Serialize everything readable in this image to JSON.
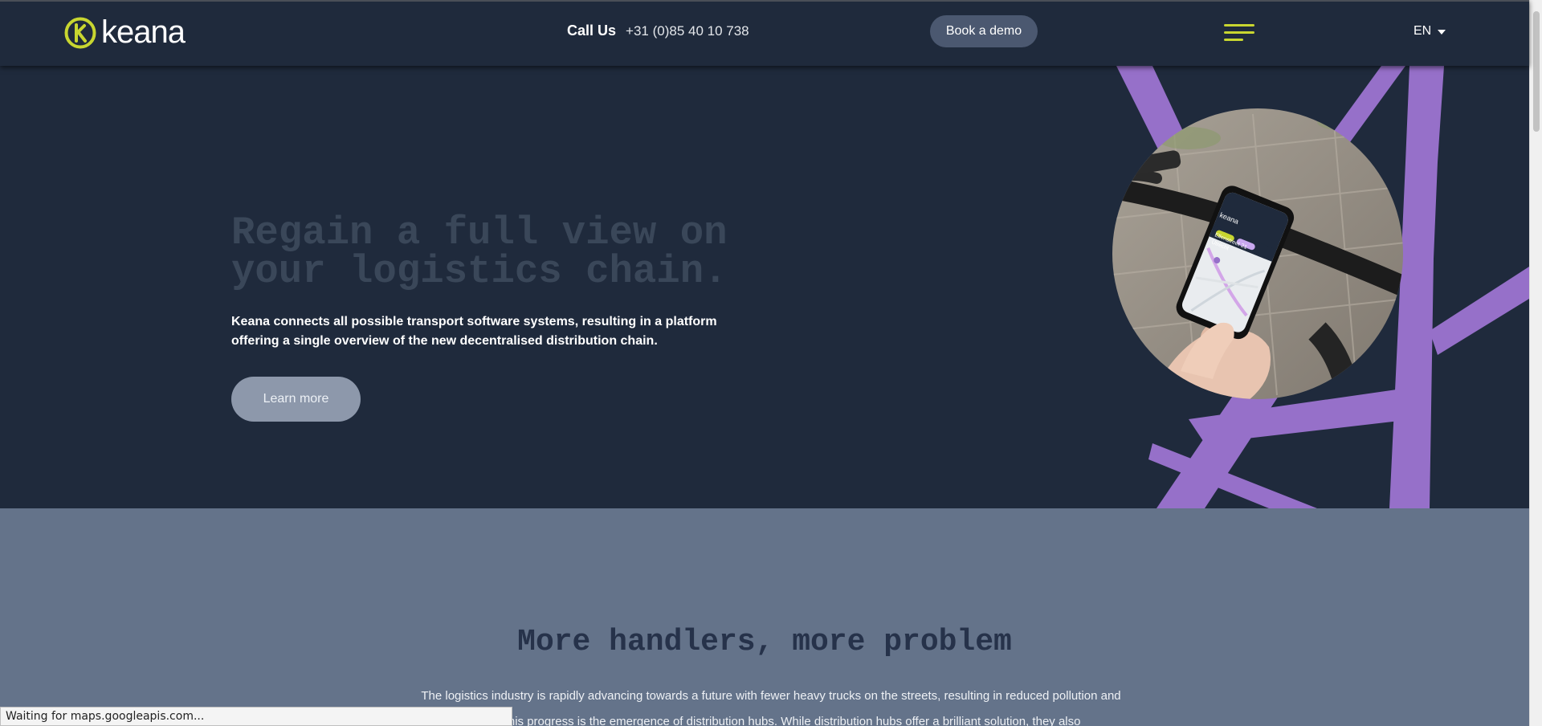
{
  "header": {
    "logo_text": "keana",
    "call_label": "Call Us",
    "call_number": "+31 (0)85 40 10 738",
    "demo_button": "Book a demo",
    "language": "EN"
  },
  "hero": {
    "title": "Regain a full view on your logistics chain.",
    "description": "Keana connects all possible transport software systems, resulting in a platform offering a single overview of the new decentralised distribution chain.",
    "cta": "Learn more",
    "phone_logo": "keana",
    "phone_address_line1": "Ellenstreet 21",
    "phone_address_line2": "Utrecht"
  },
  "section2": {
    "title": "More handlers, more problem",
    "text": "The logistics industry is rapidly advancing towards a future with fewer heavy trucks on the streets, resulting in reduced pollution and ... ral to this progress is the emergence of distribution hubs. While distribution hubs offer a brilliant solution, they also"
  },
  "statusbar": {
    "text": "Waiting for maps.googleapis.com..."
  },
  "colors": {
    "navy": "#1f2a3c",
    "accent_yellow": "#c8d630",
    "purple": "#9670c9",
    "slate": "#64738a"
  },
  "icons": [
    "keana-logo-icon",
    "hamburger-menu-icon",
    "caret-down-icon"
  ]
}
